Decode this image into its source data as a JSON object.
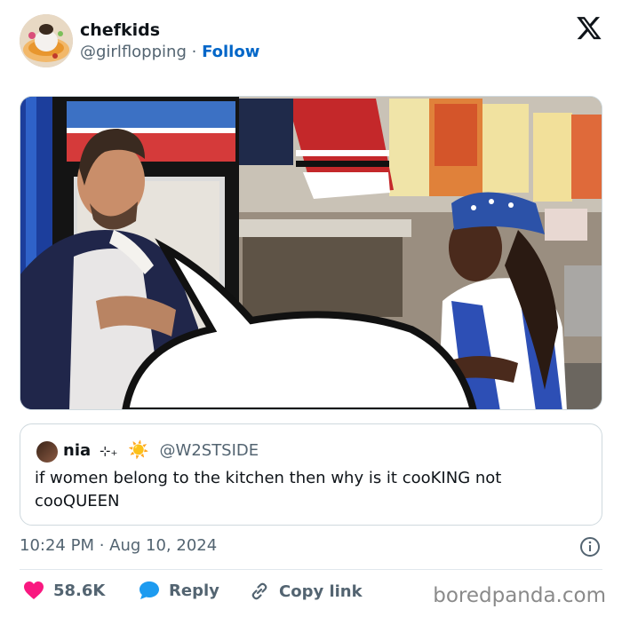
{
  "author": {
    "name": "chefkids",
    "handle": "@girlflopping",
    "separator": "·",
    "follow_label": "Follow"
  },
  "brand_icon": "x-logo-icon",
  "media": {
    "description_icon": "photo-kitchen-scene"
  },
  "quoted_tweet": {
    "name": "nia",
    "symbols": "⊹₊",
    "sun": "☀️",
    "handle": "@W2STSIDE",
    "text": "if women belong to the kitchen then why is it cooKING not cooQUEEN"
  },
  "meta": {
    "timestamp": "10:24 PM · Aug 10, 2024",
    "info_icon": "info-icon"
  },
  "actions": {
    "like_count": "58.6K",
    "reply_label": "Reply",
    "copy_label": "Copy link"
  },
  "watermark": "boredpanda.com",
  "colors": {
    "accent": "#0066c8",
    "like": "#f91880",
    "reply": "#1d9bf0",
    "muted": "#536471"
  }
}
